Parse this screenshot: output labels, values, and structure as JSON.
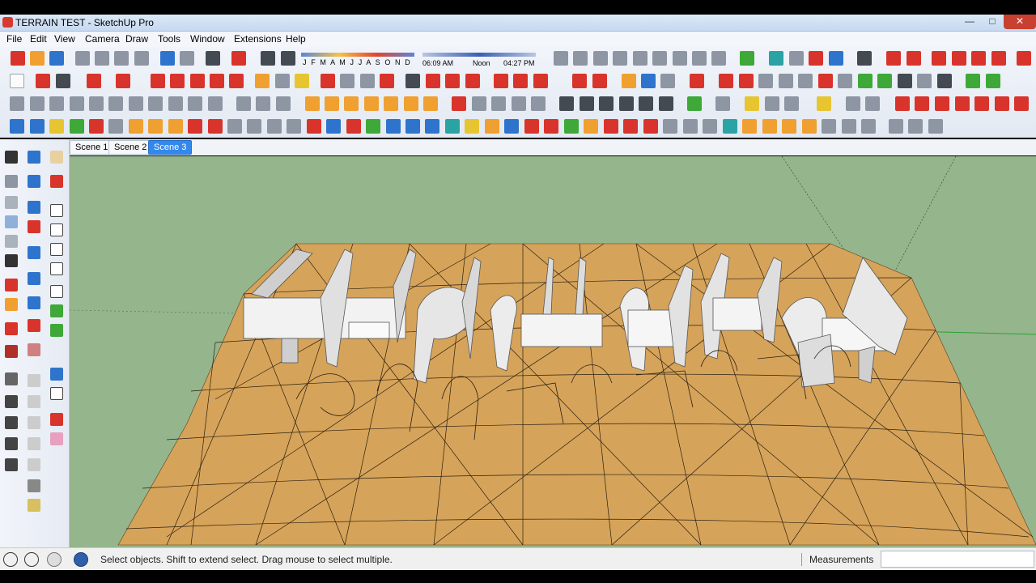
{
  "window": {
    "title": "TERRAIN TEST - SketchUp Pro"
  },
  "menu": [
    "File",
    "Edit",
    "View",
    "Camera",
    "Draw",
    "Tools",
    "Window",
    "Extensions",
    "Help"
  ],
  "shadows": {
    "months": "J F M A M J J A S O N D",
    "time_start": "06:09 AM",
    "time_mid": "Noon",
    "time_end": "04:27 PM"
  },
  "scenes": [
    "Scene 1",
    "Scene 2",
    "Scene 3"
  ],
  "active_scene": "Scene 3",
  "status": {
    "hint": "Select objects. Shift to extend select. Drag mouse to select multiple.",
    "measurements_label": "Measurements",
    "measurements_value": ""
  },
  "colors": {
    "sky": "#95b58d",
    "terrain": "#d6a35a",
    "model": "#f2f2f2",
    "active_tab": "#3388ee"
  },
  "icons": [
    "app-icon",
    "select-icon",
    "eraser-icon",
    "pencil-icon",
    "orbit-icon",
    "pan-icon",
    "zoom-icon",
    "geo-location-icon",
    "credits-icon",
    "user-icon",
    "help-icon"
  ]
}
